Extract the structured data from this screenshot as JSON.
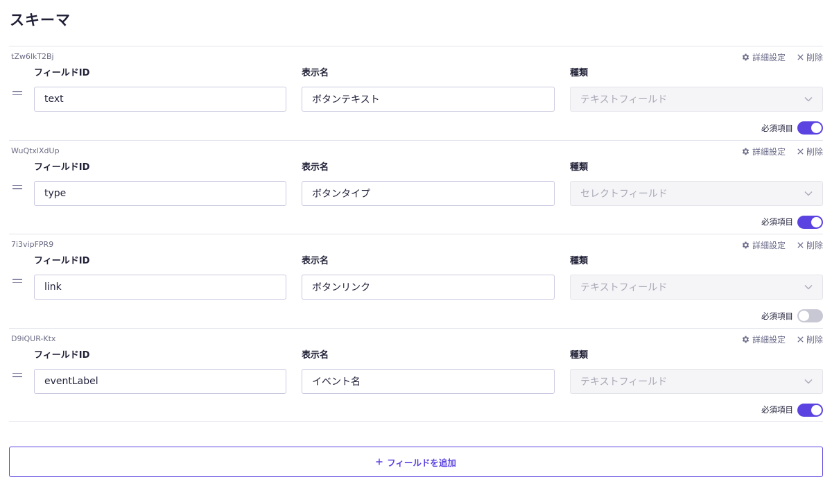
{
  "page": {
    "title": "スキーマ"
  },
  "labels": {
    "field_id": "フィールドID",
    "display_name": "表示名",
    "type": "種類",
    "required": "必須項目",
    "advanced": "詳細設定",
    "delete": "削除"
  },
  "fields": [
    {
      "key": "tZw6lkT2Bj",
      "field_id": "text",
      "display_name": "ボタンテキスト",
      "type": "テキストフィールド",
      "required": true
    },
    {
      "key": "WuQtxlXdUp",
      "field_id": "type",
      "display_name": "ボタンタイプ",
      "type": "セレクトフィールド",
      "required": true
    },
    {
      "key": "7i3vipFPR9",
      "field_id": "link",
      "display_name": "ボタンリンク",
      "type": "テキストフィールド",
      "required": false
    },
    {
      "key": "D9iQUR-Ktx",
      "field_id": "eventLabel",
      "display_name": "イベント名",
      "type": "テキストフィールド",
      "required": true
    }
  ],
  "add_button": {
    "label": "フィールドを追加"
  },
  "colors": {
    "accent": "#5a43e0",
    "toggle_off": "#c8c8d4",
    "border": "#e3e3ec"
  },
  "icons": {
    "advanced": "gear-icon",
    "delete": "close-icon",
    "drag": "drag-handle-icon",
    "select": "chevron-down-icon",
    "add": "plus-icon"
  }
}
